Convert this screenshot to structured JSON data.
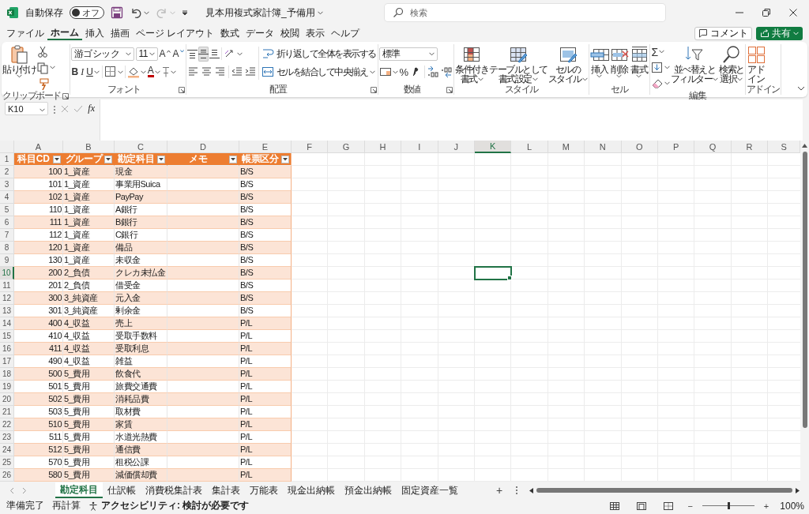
{
  "title_bar": {
    "autosave_label": "自動保存",
    "autosave_toggle": {
      "label": "オフ",
      "on": false
    },
    "redo_disabled": true,
    "document_title": "見本用複式家計簿_予備用",
    "search": {
      "placeholder": "検索"
    }
  },
  "menu_tabs": [
    {
      "label": "ファイル",
      "selected": false
    },
    {
      "label": "ホーム",
      "selected": true
    },
    {
      "label": "挿入",
      "selected": false
    },
    {
      "label": "描画",
      "selected": false
    },
    {
      "label": "ページ レイアウト",
      "selected": false
    },
    {
      "label": "数式",
      "selected": false
    },
    {
      "label": "データ",
      "selected": false
    },
    {
      "label": "校閲",
      "selected": false
    },
    {
      "label": "表示",
      "selected": false
    },
    {
      "label": "ヘルプ",
      "selected": false
    }
  ],
  "comment_button": {
    "label": "コメント"
  },
  "share_button": {
    "label": "共有"
  },
  "ribbon": {
    "groups": [
      {
        "kind": "clipboard",
        "title": "クリップボード",
        "paste_label": "貼り付け",
        "launcher": true
      },
      {
        "kind": "font",
        "title": "フォント",
        "font_name": "游ゴシック",
        "font_size": "11",
        "grow_label": "A",
        "shrink_label": "A",
        "style_buttons": [
          "B",
          "I",
          "U"
        ],
        "font_color_label": "A",
        "launcher": true
      },
      {
        "kind": "alignment",
        "title": "配置",
        "vertical_align": [
          {
            "selected": false
          },
          {
            "selected": true
          },
          {
            "selected": false
          }
        ],
        "wrap_label": "折り返して全体を表示する",
        "merge_label": "セルを結合して中央揃え",
        "launcher": true
      },
      {
        "kind": "number",
        "title": "数値",
        "format": "標準",
        "percent_label": "%",
        "launcher": true
      },
      {
        "kind": "styles",
        "title": "スタイル",
        "buttons": [
          {
            "lines": [
              "条件付き",
              "書式"
            ]
          },
          {
            "lines": [
              "テーブルとして",
              "書式設定"
            ]
          },
          {
            "lines": [
              "セルの",
              "スタイル"
            ]
          }
        ]
      },
      {
        "kind": "cells",
        "title": "セル",
        "buttons": [
          {
            "lines": [
              "挿入"
            ]
          },
          {
            "lines": [
              "削除"
            ]
          },
          {
            "lines": [
              "書式"
            ]
          }
        ]
      },
      {
        "kind": "editing",
        "title": "編集",
        "autosum_label": "Σ",
        "buttons": [
          {
            "lines": [
              "並べ替えと",
              "フィルター"
            ]
          },
          {
            "lines": [
              "検索と",
              "選択"
            ]
          }
        ]
      },
      {
        "kind": "addins",
        "title": "アドイン",
        "buttons": [
          {
            "lines": [
              "アド",
              "イン"
            ]
          }
        ]
      }
    ]
  },
  "formula_bar": {
    "name_box": "K10",
    "function_label": "fx"
  },
  "sheet": {
    "columns": [
      {
        "label": "A",
        "selected": false
      },
      {
        "label": "B",
        "selected": false
      },
      {
        "label": "C",
        "selected": false
      },
      {
        "label": "D",
        "selected": false
      },
      {
        "label": "E",
        "selected": false
      },
      {
        "label": "F",
        "selected": false
      },
      {
        "label": "G",
        "selected": false
      },
      {
        "label": "H",
        "selected": false
      },
      {
        "label": "I",
        "selected": false
      },
      {
        "label": "J",
        "selected": false
      },
      {
        "label": "K",
        "selected": true
      },
      {
        "label": "L",
        "selected": false
      },
      {
        "label": "M",
        "selected": false
      },
      {
        "label": "N",
        "selected": false
      },
      {
        "label": "O",
        "selected": false
      },
      {
        "label": "P",
        "selected": false
      },
      {
        "label": "Q",
        "selected": false
      },
      {
        "label": "R",
        "selected": false
      },
      {
        "label": "S",
        "selected": false
      }
    ],
    "rows": [
      {
        "label": "1",
        "selected": false
      },
      {
        "label": "2",
        "selected": false
      },
      {
        "label": "3",
        "selected": false
      },
      {
        "label": "4",
        "selected": false
      },
      {
        "label": "5",
        "selected": false
      },
      {
        "label": "6",
        "selected": false
      },
      {
        "label": "7",
        "selected": false
      },
      {
        "label": "8",
        "selected": false
      },
      {
        "label": "9",
        "selected": false
      },
      {
        "label": "10",
        "selected": true
      },
      {
        "label": "11",
        "selected": false
      },
      {
        "label": "12",
        "selected": false
      },
      {
        "label": "13",
        "selected": false
      },
      {
        "label": "14",
        "selected": false
      },
      {
        "label": "15",
        "selected": false
      },
      {
        "label": "16",
        "selected": false
      },
      {
        "label": "17",
        "selected": false
      },
      {
        "label": "18",
        "selected": false
      },
      {
        "label": "19",
        "selected": false
      },
      {
        "label": "20",
        "selected": false
      },
      {
        "label": "21",
        "selected": false
      },
      {
        "label": "22",
        "selected": false
      },
      {
        "label": "23",
        "selected": false
      },
      {
        "label": "24",
        "selected": false
      },
      {
        "label": "25",
        "selected": false
      },
      {
        "label": "26",
        "selected": false
      }
    ],
    "table": {
      "columns": [
        "科目CD",
        "グループ",
        "勘定科目",
        "メモ",
        "帳票区分"
      ],
      "rows": [
        {
          "code": "100",
          "group": "1_資産",
          "account": "現金",
          "report": "B/S"
        },
        {
          "code": "101",
          "group": "1_資産",
          "account": "事業用Suica",
          "report": "B/S"
        },
        {
          "code": "102",
          "group": "1_資産",
          "account": "PayPay",
          "report": "B/S"
        },
        {
          "code": "110",
          "group": "1_資産",
          "account": "A銀行",
          "report": "B/S"
        },
        {
          "code": "111",
          "group": "1_資産",
          "account": "B銀行",
          "report": "B/S"
        },
        {
          "code": "112",
          "group": "1_資産",
          "account": "C銀行",
          "report": "B/S"
        },
        {
          "code": "120",
          "group": "1_資産",
          "account": "備品",
          "report": "B/S"
        },
        {
          "code": "130",
          "group": "1_資産",
          "account": "未収金",
          "report": "B/S"
        },
        {
          "code": "200",
          "group": "2_負債",
          "account": "クレカ未払金",
          "report": "B/S"
        },
        {
          "code": "201",
          "group": "2_負債",
          "account": "借受金",
          "report": "B/S"
        },
        {
          "code": "300",
          "group": "3_純資産",
          "account": "元入金",
          "report": "B/S"
        },
        {
          "code": "301",
          "group": "3_純資産",
          "account": "剰余金",
          "report": "B/S"
        },
        {
          "code": "400",
          "group": "4_収益",
          "account": "売上",
          "report": "P/L"
        },
        {
          "code": "410",
          "group": "4_収益",
          "account": "受取手数料",
          "report": "P/L"
        },
        {
          "code": "411",
          "group": "4_収益",
          "account": "受取利息",
          "report": "P/L"
        },
        {
          "code": "490",
          "group": "4_収益",
          "account": "雑益",
          "report": "P/L"
        },
        {
          "code": "500",
          "group": "5_費用",
          "account": "飲食代",
          "report": "P/L"
        },
        {
          "code": "501",
          "group": "5_費用",
          "account": "旅費交通費",
          "report": "P/L"
        },
        {
          "code": "502",
          "group": "5_費用",
          "account": "消耗品費",
          "report": "P/L"
        },
        {
          "code": "503",
          "group": "5_費用",
          "account": "取材費",
          "report": "P/L"
        },
        {
          "code": "510",
          "group": "5_費用",
          "account": "家賃",
          "report": "P/L"
        },
        {
          "code": "511",
          "group": "5_費用",
          "account": "水道光熱費",
          "report": "P/L"
        },
        {
          "code": "512",
          "group": "5_費用",
          "account": "通信費",
          "report": "P/L"
        },
        {
          "code": "570",
          "group": "5_費用",
          "account": "租税公課",
          "report": "P/L"
        },
        {
          "code": "580",
          "group": "5_費用",
          "account": "減価償却費",
          "report": "P/L"
        }
      ]
    }
  },
  "sheet_tabs": [
    {
      "label": "勘定科目",
      "selected": true
    },
    {
      "label": "仕訳帳",
      "selected": false
    },
    {
      "label": "消費税集計表",
      "selected": false
    },
    {
      "label": "集計表",
      "selected": false
    },
    {
      "label": "万能表",
      "selected": false
    },
    {
      "label": "現金出納帳",
      "selected": false
    },
    {
      "label": "預金出納帳",
      "selected": false
    },
    {
      "label": "固定資産一覧",
      "selected": false
    }
  ],
  "add_sheet_label": "+",
  "status_bar": {
    "ready": "準備完了",
    "recalc": "再計算",
    "accessibility": "アクセシビリティ: 検討が必要です",
    "zoom_out_label": "−",
    "zoom_in_label": "+",
    "zoom": {
      "level": 0.5
    },
    "zoom_reading": "100%"
  }
}
